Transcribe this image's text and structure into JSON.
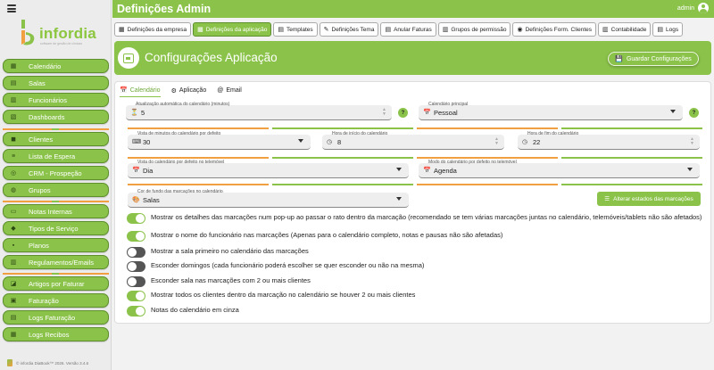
{
  "app": {
    "header_title": "Definições Admin",
    "user_name": "admin",
    "logo_text": "infordia",
    "logo_subtext": "software de gestão de clínicas"
  },
  "sidebar": {
    "items": [
      {
        "label": "Calendário",
        "icon": "calendar-icon"
      },
      {
        "label": "Salas",
        "icon": "room-icon"
      },
      {
        "label": "Funcionários",
        "icon": "staff-icon"
      },
      {
        "label": "Dashboards",
        "icon": "dashboard-icon"
      },
      {
        "label": "Clientes",
        "icon": "clients-icon"
      },
      {
        "label": "Lista de Espera",
        "icon": "waitlist-icon"
      },
      {
        "label": "CRM - Prospeção",
        "icon": "crm-icon"
      },
      {
        "label": "Grupos",
        "icon": "groups-icon"
      },
      {
        "label": "Notas Internas",
        "icon": "notes-icon"
      },
      {
        "label": "Tipos de Serviço",
        "icon": "service-icon"
      },
      {
        "label": "Planos",
        "icon": "plans-icon"
      },
      {
        "label": "Regulamentos/Emails",
        "icon": "email-icon"
      },
      {
        "label": "Artigos por Faturar",
        "icon": "articles-icon"
      },
      {
        "label": "Faturação",
        "icon": "invoice-icon"
      },
      {
        "label": "Logs Faturação",
        "icon": "logs-icon"
      },
      {
        "label": "Logs Recibos",
        "icon": "receipt-icon"
      }
    ],
    "footer": "© infordia DiaBook™ 2026. Versão 3.4.6"
  },
  "tabs": [
    {
      "label": "Definições da empresa",
      "active": false
    },
    {
      "label": "Definições da aplicação",
      "active": true
    },
    {
      "label": "Templates",
      "active": false
    },
    {
      "label": "Definições Tema",
      "active": false
    },
    {
      "label": "Anular Faturas",
      "active": false
    },
    {
      "label": "Grupos de permissão",
      "active": false
    },
    {
      "label": "Definições Form. Clientes",
      "active": false
    },
    {
      "label": "Contabilidade",
      "active": false
    },
    {
      "label": "Logs",
      "active": false
    }
  ],
  "panel": {
    "title": "Configurações Aplicação",
    "save_label": "Guardar Configurações"
  },
  "subtabs": [
    {
      "label": "Calendário",
      "active": true
    },
    {
      "label": "Aplicação",
      "active": false
    },
    {
      "label": "Email",
      "active": false
    }
  ],
  "fields": {
    "auto_update": {
      "label": "Atualização automática do calendário (minutos)",
      "value": "5"
    },
    "main_calendar": {
      "label": "Calendário principal",
      "value": "Pessoal"
    },
    "minutes_view": {
      "label": "Vista de minutos do calendário por defeito",
      "value": "30"
    },
    "start_time": {
      "label": "Hora de início do calendário",
      "value": "8"
    },
    "end_time": {
      "label": "Hora de fim do calendário",
      "value": "22"
    },
    "mobile_view": {
      "label": "Vista do calendário por defeito no telemóvel",
      "value": "Dia"
    },
    "mobile_mode": {
      "label": "Modo do calendário por defeito no telemóvel",
      "value": "Agenda"
    },
    "bg_color": {
      "label": "Cor de fundo das marcações no calendário",
      "value": "Salas"
    }
  },
  "alter_states_label": "Alterar estados das marcações",
  "toggles": [
    {
      "label": "Mostrar os detalhes das marcações num pop-up ao passar o rato dentro da marcação (recomendado se tem várias marcações juntas no calendário, telemóveis/tablets não são afetados)",
      "on": true
    },
    {
      "label": "Mostrar o nome do funcionário nas marcações (Apenas para o calendário completo, notas e pausas não são afetadas)",
      "on": true
    },
    {
      "label": "Mostrar a sala primeiro no calendário das marcações",
      "on": false
    },
    {
      "label": "Esconder domingos (cada funcionário poderá escolher se quer esconder ou não na mesma)",
      "on": false
    },
    {
      "label": "Esconder sala nas marcações com 2 ou mais clientes",
      "on": false
    },
    {
      "label": "Mostrar todos os clientes dentro da marcação no calendário se houver 2 ou mais clientes",
      "on": true
    },
    {
      "label": "Notas do calendário em cinza",
      "on": true
    }
  ],
  "colors": {
    "brand_green": "#8bc34a",
    "accent_orange": "#f0a040"
  }
}
